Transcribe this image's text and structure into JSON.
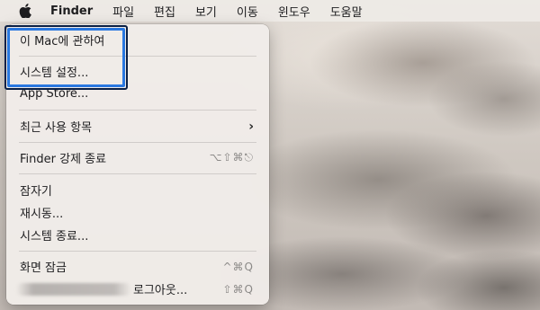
{
  "menubar": {
    "apple_icon": "apple-logo-icon",
    "app_name": "Finder",
    "items": [
      "파일",
      "편집",
      "보기",
      "이동",
      "윈도우",
      "도움말"
    ]
  },
  "apple_menu": {
    "about": "이 Mac에 관하여",
    "settings": "시스템 설정...",
    "app_store": "App Store...",
    "recent_items": "최근 사용 항목",
    "recent_items_icon": "chevron-right-icon",
    "force_quit": "Finder 강제 종료",
    "force_quit_shortcut": "⌥⇧⌘⎋",
    "sleep": "잠자기",
    "restart": "재시동...",
    "shutdown": "시스템 종료...",
    "lock_screen": "화면 잠금",
    "lock_screen_shortcut": "^⌘Q",
    "logout": "로그아웃...",
    "logout_shortcut": "⇧⌘Q"
  },
  "colors": {
    "highlight_inner": "#2a78e0",
    "highlight_outer": "#0a1f44"
  }
}
